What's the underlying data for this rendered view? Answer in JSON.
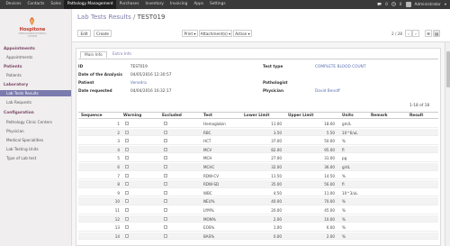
{
  "topbar": {
    "menu": [
      "Devices",
      "Contacts",
      "Sales",
      "Pathology Management",
      "Purchases",
      "Inventory",
      "Invoicing",
      "Apps",
      "Settings"
    ],
    "active_index": 3,
    "icons": [
      "chat-icon",
      "clock-icon"
    ],
    "icon_text": [
      "0",
      "0"
    ],
    "user": "Administrator"
  },
  "sidebar": {
    "logo_brand": "Hospitone",
    "logo_tag": "OPEN SOURCE HOSPITAL SYSTEM",
    "sections": [
      {
        "title": "Appointments",
        "items": [
          "Appointments"
        ]
      },
      {
        "title": "Patients",
        "items": [
          "Patients"
        ]
      },
      {
        "title": "Laboratory",
        "items": [
          "Lab Tests Results",
          "Lab Requests"
        ]
      },
      {
        "title": "Configuration",
        "items": [
          "Pathology Clinic Centers",
          "Physician",
          "Medical Specialities",
          "Lab Testing Units",
          "Type of Lab test"
        ]
      }
    ],
    "active_item": "Lab Tests Results"
  },
  "breadcrumb": {
    "parent": "Lab Tests Results",
    "separator": "/",
    "current": "TEST019"
  },
  "buttons": {
    "edit": "Edit",
    "create": "Create",
    "print": "Print ▾",
    "attachments": "Attachment(s) ▾",
    "action": "Action ▾"
  },
  "pager": {
    "text": "2 / 28"
  },
  "tabs": [
    "Main Info",
    "Extra Info"
  ],
  "form": {
    "test_id_label": "ID",
    "test_id": "TEST019",
    "date_analysis_label": "Date of the Analysis",
    "date_analysis": "04/05/2016 12:30:57",
    "patient_label": "Patient",
    "patient": "Venedra",
    "date_requested_label": "Date requested",
    "date_requested": "04/04/2016 16:32:17",
    "test_type_label": "Test type",
    "test_type": "COMPLETE BLOOD COUNT",
    "pathologist_label": "Pathologist",
    "pathologist": "",
    "physician_label": "Physician",
    "physician": "David Benoff"
  },
  "table": {
    "record_count": "1-18 of 18",
    "headers": [
      "Sequence",
      "Warning",
      "Excluded",
      "Test",
      "Lower Limit",
      "Upper Limit",
      "Units",
      "Remark",
      "Result"
    ],
    "rows": [
      {
        "seq": "1",
        "test": "Hemoglobin",
        "lower": "11.00",
        "upper": "18.00",
        "units": "gm/L"
      },
      {
        "seq": "2",
        "test": "RBC",
        "lower": "3.50",
        "upper": "5.50",
        "units": "10^6/uL"
      },
      {
        "seq": "3",
        "test": "HCT",
        "lower": "37.00",
        "upper": "50.00",
        "units": "%"
      },
      {
        "seq": "4",
        "test": "MCV",
        "lower": "82.00",
        "upper": "95.00",
        "units": "fl"
      },
      {
        "seq": "5",
        "test": "MCH",
        "lower": "27.00",
        "upper": "31.00",
        "units": "pg"
      },
      {
        "seq": "6",
        "test": "MCHC",
        "lower": "32.00",
        "upper": "36.00",
        "units": "g/dL"
      },
      {
        "seq": "7",
        "test": "RDW-CV",
        "lower": "11.50",
        "upper": "14.50",
        "units": "%"
      },
      {
        "seq": "8",
        "test": "RDW-SD",
        "lower": "35.00",
        "upper": "56.00",
        "units": "fl"
      },
      {
        "seq": "9",
        "test": "WBC",
        "lower": "4.50",
        "upper": "11.00",
        "units": "10^3/uL"
      },
      {
        "seq": "10",
        "test": "NEU%",
        "lower": "40.00",
        "upper": "70.00",
        "units": "%"
      },
      {
        "seq": "11",
        "test": "LYM%",
        "lower": "20.00",
        "upper": "45.00",
        "units": "%"
      },
      {
        "seq": "12",
        "test": "MON%",
        "lower": "2.00",
        "upper": "10.00",
        "units": "%"
      },
      {
        "seq": "13",
        "test": "EOS%",
        "lower": "1.00",
        "upper": "6.00",
        "units": "%"
      },
      {
        "seq": "14",
        "test": "BAS%",
        "lower": "0.00",
        "upper": "2.00",
        "units": "%"
      }
    ]
  },
  "colors": {
    "accent": "#7c7bad",
    "topbar": "#3a3a3a",
    "section": "#7c4a6b",
    "link": "#5a6fb3"
  }
}
